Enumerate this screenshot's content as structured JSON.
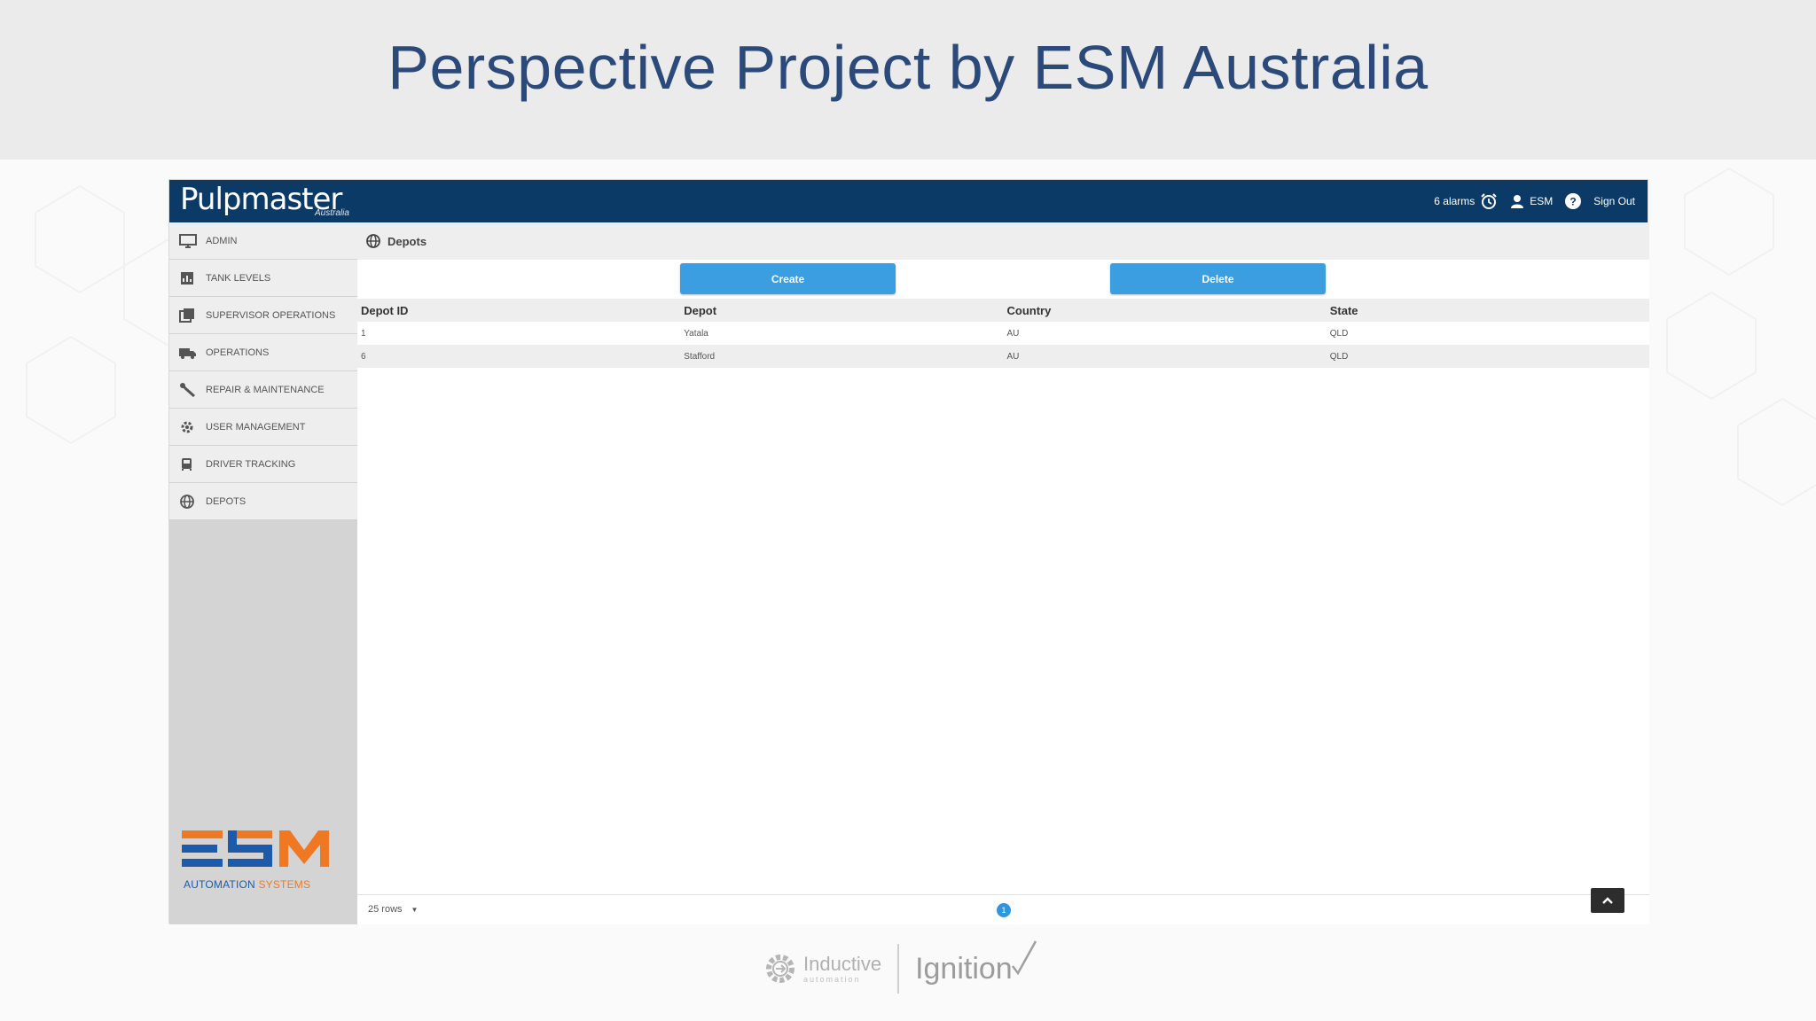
{
  "slide": {
    "title": "Perspective Project by ESM Australia"
  },
  "topbar": {
    "brand": "Pulpmaster",
    "brand_sub": "Australia",
    "alarms": "6 alarms",
    "user": "ESM",
    "sign_out": "Sign Out"
  },
  "sidebar": {
    "items": [
      {
        "label": "ADMIN",
        "icon": "monitor-icon"
      },
      {
        "label": "TANK LEVELS",
        "icon": "chart-icon"
      },
      {
        "label": "SUPERVISOR OPERATIONS",
        "icon": "layers-icon"
      },
      {
        "label": "OPERATIONS",
        "icon": "truck-icon"
      },
      {
        "label": "REPAIR & MAINTENANCE",
        "icon": "wrench-icon"
      },
      {
        "label": "USER MANAGEMENT",
        "icon": "gear-icon"
      },
      {
        "label": "DRIVER TRACKING",
        "icon": "bus-icon"
      },
      {
        "label": "DEPOTS",
        "icon": "globe-icon"
      }
    ],
    "logo_caption_a": "AUTOMATION",
    "logo_caption_b": "SYSTEMS"
  },
  "main": {
    "breadcrumb": "Depots",
    "create_label": "Create",
    "delete_label": "Delete",
    "table": {
      "columns": [
        "Depot ID",
        "Depot",
        "Country",
        "State"
      ],
      "rows": [
        [
          "1",
          "Yatala",
          "AU",
          "QLD"
        ],
        [
          "6",
          "Stafford",
          "AU",
          "QLD"
        ]
      ]
    },
    "footer": {
      "rows_per_page": "25 rows",
      "page": "1"
    }
  },
  "bottom": {
    "inductive": "Inductive",
    "inductive_sub": "automation",
    "ignition": "Ignition"
  },
  "colors": {
    "topbar": "#0b3a66",
    "button": "#3a9ee0",
    "title": "#2b4a7a",
    "esm_blue": "#1e5aa8",
    "esm_orange": "#f07822"
  }
}
